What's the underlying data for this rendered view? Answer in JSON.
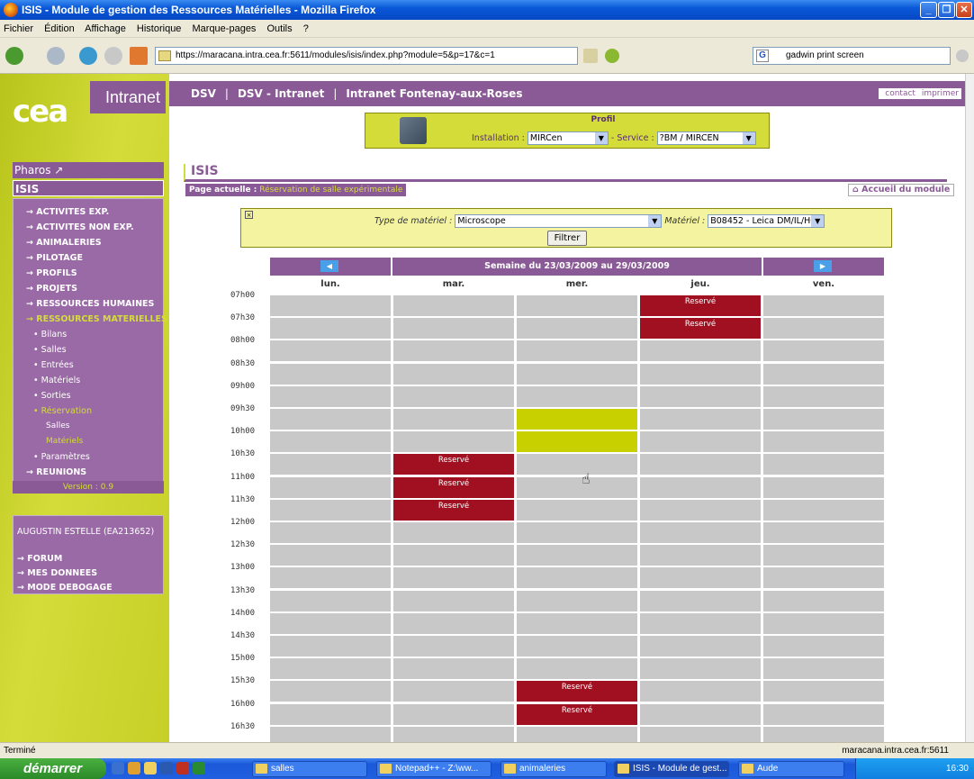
{
  "window": {
    "title": "ISIS - Module de gestion des Ressources Matérielles - Mozilla Firefox"
  },
  "menubar": [
    "Fichier",
    "Édition",
    "Affichage",
    "Historique",
    "Marque-pages",
    "Outils",
    "?"
  ],
  "browser": {
    "url": "https://maracana.intra.cea.fr:5611/modules/isis/index.php?module=5&p=17&c=1",
    "search_value": "gadwin print screen"
  },
  "site": {
    "logo_text": "cea",
    "intranet_label": "Intranet",
    "topnav": [
      "DSV",
      "DSV - Intranet",
      "Intranet Fontenay-aux-Roses"
    ],
    "top_links": [
      "contact",
      "imprimer"
    ]
  },
  "profil": {
    "title": "Profil",
    "installation_label": "Installation :",
    "installation_value": "MIRCen",
    "service_label": "- Service :",
    "service_value": "?BM / MIRCEN"
  },
  "sidebar": {
    "pharos": "Pharos",
    "isis": "ISIS",
    "menu": [
      {
        "label": "ACTIVITES EXP.",
        "level": 0
      },
      {
        "label": "ACTIVITES NON EXP.",
        "level": 0
      },
      {
        "label": "ANIMALERIES",
        "level": 0
      },
      {
        "label": "PILOTAGE",
        "level": 0
      },
      {
        "label": "PROFILS",
        "level": 0
      },
      {
        "label": "PROJETS",
        "level": 0
      },
      {
        "label": "RESSOURCES HUMAINES",
        "level": 0
      },
      {
        "label": "RESSOURCES MATERIELLES",
        "level": 0,
        "active": true
      },
      {
        "label": "Bilans",
        "level": 1
      },
      {
        "label": "Salles",
        "level": 1
      },
      {
        "label": "Entrées",
        "level": 1
      },
      {
        "label": "Matériels",
        "level": 1
      },
      {
        "label": "Sorties",
        "level": 1
      },
      {
        "label": "Réservation",
        "level": 1,
        "active": true
      },
      {
        "label": "Salles",
        "level": 2
      },
      {
        "label": "Matériels",
        "level": 2,
        "active": true
      },
      {
        "label": "Paramètres",
        "level": 1
      },
      {
        "label": "REUNIONS",
        "level": 0
      }
    ],
    "version": "Version : 0.9",
    "user_name": "AUGUSTIN ESTELLE (EA213652)",
    "user_menu": [
      "FORUM",
      "MES DONNEES",
      "MODE DEBOGAGE"
    ]
  },
  "main": {
    "title": "ISIS",
    "page_actuelle_label": "Page actuelle :",
    "page_actuelle_value": "Réservation de salle expérimentale",
    "accueil": "Accueil du module"
  },
  "filter": {
    "type_label": "Type de matériel :",
    "type_value": "Microscope",
    "materiel_label": "Matériel :",
    "materiel_value": "B08452 - Leica DM/IL/HC",
    "button": "Filtrer"
  },
  "calendar": {
    "week_title": "Semaine du 23/03/2009 au 29/03/2009",
    "days": [
      "lun.",
      "mar.",
      "mer.",
      "jeu.",
      "ven."
    ],
    "times": [
      "07h00",
      "07h30",
      "08h00",
      "08h30",
      "09h00",
      "09h30",
      "10h00",
      "10h30",
      "11h00",
      "11h30",
      "12h00",
      "12h30",
      "13h00",
      "13h30",
      "14h00",
      "14h30",
      "15h00",
      "15h30",
      "16h00",
      "16h30"
    ],
    "reserved_label": "Reservé",
    "reserved": [
      {
        "day": 3,
        "slot": 0
      },
      {
        "day": 3,
        "slot": 1
      },
      {
        "day": 1,
        "slot": 7
      },
      {
        "day": 1,
        "slot": 8
      },
      {
        "day": 1,
        "slot": 9
      },
      {
        "day": 2,
        "slot": 17
      },
      {
        "day": 2,
        "slot": 18
      }
    ],
    "highlighted": [
      {
        "day": 2,
        "slot": 5
      },
      {
        "day": 2,
        "slot": 6
      }
    ]
  },
  "status": {
    "left": "Terminé",
    "right": "maracana.intra.cea.fr:5611"
  },
  "taskbar": {
    "start": "démarrer",
    "tasks": [
      "salles",
      "Notepad++ - Z:\\ww...",
      "animaleries",
      "ISIS - Module de gest...",
      "Aude"
    ],
    "clock": "16:30"
  }
}
